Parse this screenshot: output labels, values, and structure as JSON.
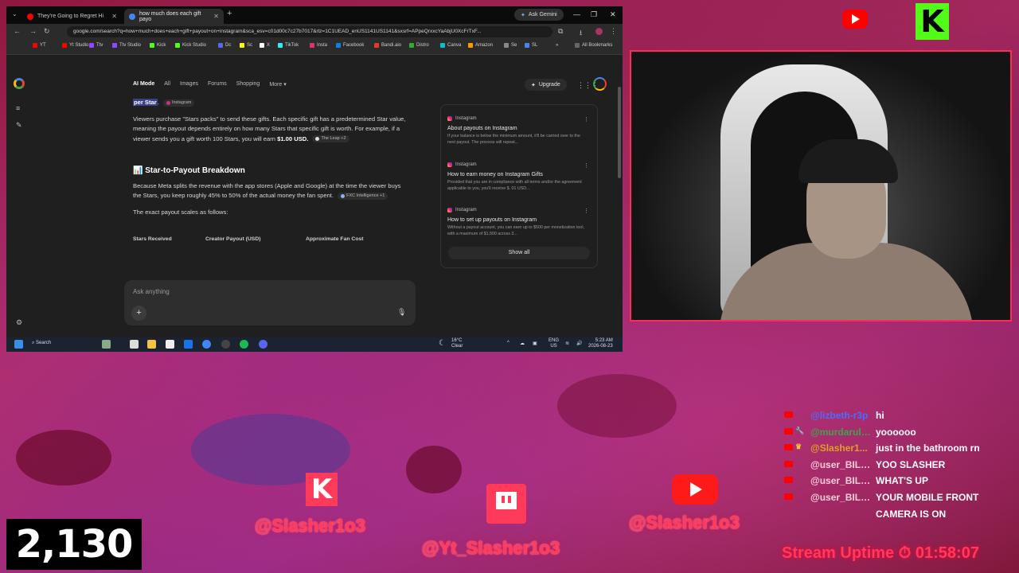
{
  "colors": {
    "accent_red": "#ff3a5a",
    "kick_green": "#53fc18",
    "youtube_red": "#ff0000"
  },
  "browser": {
    "tabs": [
      {
        "title": "They're Going to Regret Hi",
        "active": false
      },
      {
        "title": "how much does each gift payo",
        "active": true
      }
    ],
    "new_tab": "+",
    "ask_gemini": "Ask Gemini",
    "url": "google.com/search?q=how+much+does+each+gift+payout+on+instagram&sca_esv=c01d00c7c27b7017&rlz=1C1UEAD_enUS1141US1141&sxsrf=APpeQrxxcYaAbjU0XcFrTxF...",
    "bookmarks": [
      "YT",
      "Yt Studio",
      "Ttv",
      "Ttv Studio",
      "Kick",
      "Kick Studio",
      "Dc",
      "Sc",
      "X",
      "TikTok",
      "Insta",
      "Facebook",
      "Bandi.aio",
      "Distro",
      "Canva",
      "Amazon",
      "Se",
      "SL"
    ],
    "all_bookmarks": "All Bookmarks"
  },
  "google": {
    "tabs": [
      "AI Mode",
      "All",
      "Images",
      "Forums",
      "Shopping",
      "More"
    ],
    "upgrade": "Upgrade",
    "answer": {
      "line0_highlight": "per Star",
      "line0_chip": "Instagram",
      "para1": "Viewers purchase \"Stars packs\" to send these gifts. Each specific gift has a predetermined Star value, meaning the payout depends entirely on how many Stars that specific gift is worth. For example, if a viewer sends you a gift worth 100 Stars, you will earn",
      "para1_bold": "$1.00 USD.",
      "para1_chip": "The Leap +2",
      "heading": "Star-to-Payout Breakdown",
      "para2": "Because Meta splits the revenue with the app stores (Apple and Google) at the time the viewer buys the Stars, you keep roughly 45% to 50% of the actual money the fan spent.",
      "para2_chip": "FXC Intelligence +1",
      "para3": "The exact payout scales as follows:",
      "table_headers": [
        "Stars Received",
        "Creator Payout (USD)",
        "Approximate Fan Cost"
      ]
    },
    "sources": [
      {
        "site": "Instagram",
        "title": "About payouts on Instagram",
        "snippet": "If your balance is below the minimum amount, it'll be carried over to the next payout. The process will repeat..."
      },
      {
        "site": "Instagram",
        "title": "How to earn money on Instagram Gifts",
        "snippet": "Provided that you are in compliance with all terms and/or the agreement applicable to you, you'll receive $. 01 USD..."
      },
      {
        "site": "Instagram",
        "title": "How to set up payouts on Instagram",
        "snippet": "Without a payout account, you can earn up to $500 per monetization tool, with a maximum of $1,500 across 3..."
      }
    ],
    "show_all": "Show all",
    "ask_placeholder": "Ask anything"
  },
  "taskbar": {
    "search": "Search",
    "weather_temp": "16°C",
    "weather_desc": "Clear",
    "lang": "ENG",
    "region": "US",
    "time": "5:23 AM",
    "date": "2026-08-23"
  },
  "chat": [
    {
      "user": "@lizbeth-r3p",
      "user_color": "#4d6bff",
      "badge": "",
      "text": "hi"
    },
    {
      "user": "@murdaruld...",
      "user_color": "#3fa34d",
      "badge": "🔧",
      "text": "yoooooo"
    },
    {
      "user": "@Slasher1...",
      "user_color": "#e0a020",
      "badge": "♛",
      "text": "just in the bathroom rn"
    },
    {
      "user": "@user_BILLU...",
      "user_color": "#ffd0dc",
      "badge": "",
      "text": "YOO SLASHER"
    },
    {
      "user": "@user_BILLU...",
      "user_color": "#ffd0dc",
      "badge": "",
      "text": "WHAT'S UP"
    },
    {
      "user": "@user_BILLU...",
      "user_color": "#ffd0dc",
      "badge": "",
      "text": "YOUR MOBILE FRONT"
    },
    {
      "user": "",
      "user_color": "#ffd0dc",
      "badge": "",
      "text": "CAMERA IS ON"
    }
  ],
  "overlay": {
    "kick_handle": "@Slasher1o3",
    "twitch_handle": "@Yt_Slasher1o3",
    "youtube_handle": "@Slasher1o3",
    "counter": "2,130",
    "uptime_label": "Stream Uptime",
    "uptime_value": "01:58:07",
    "kick_letter": "K"
  }
}
